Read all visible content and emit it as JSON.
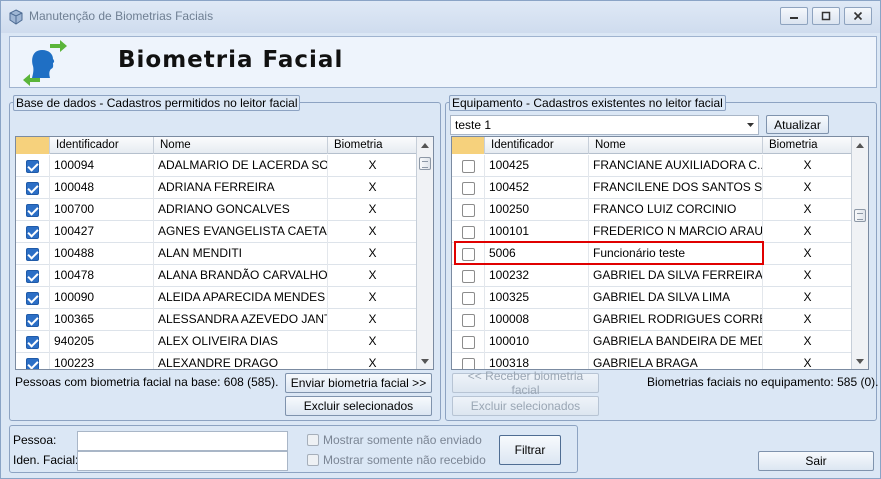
{
  "window": {
    "title": "Manutenção de Biometrias Faciais"
  },
  "header": {
    "title": "Biometria Facial"
  },
  "left_panel": {
    "group_label": "Base de dados - Cadastros permitidos no leitor facial",
    "columns": [
      "Identificador",
      "Nome",
      "Biometria"
    ],
    "rows": [
      {
        "checked": true,
        "id": "100094",
        "name": "ADALMARIO DE LACERDA SO...",
        "bio": "X"
      },
      {
        "checked": true,
        "id": "100048",
        "name": "ADRIANA FERREIRA",
        "bio": "X"
      },
      {
        "checked": true,
        "id": "100700",
        "name": "ADRIANO GONCALVES",
        "bio": "X"
      },
      {
        "checked": true,
        "id": "100427",
        "name": "AGNES EVANGELISTA CAETA...",
        "bio": "X"
      },
      {
        "checked": true,
        "id": "100488",
        "name": "ALAN MENDITI",
        "bio": "X"
      },
      {
        "checked": true,
        "id": "100478",
        "name": "ALANA BRANDÃO CARVALHO",
        "bio": "X"
      },
      {
        "checked": true,
        "id": "100090",
        "name": "ALEIDA APARECIDA MENDES ...",
        "bio": "X"
      },
      {
        "checked": true,
        "id": "100365",
        "name": "ALESSANDRA AZEVEDO JANT...",
        "bio": "X"
      },
      {
        "checked": true,
        "id": "940205",
        "name": "ALEX OLIVEIRA DIAS",
        "bio": "X"
      },
      {
        "checked": true,
        "id": "100223",
        "name": "ALEXANDRE DRAGO",
        "bio": "X"
      }
    ],
    "scroll_position": 0.02,
    "count_label": "Pessoas com biometria facial na base: 608 (585).",
    "send_button": "Enviar biometria facial >>",
    "delete_button": "Excluir selecionados"
  },
  "right_panel": {
    "group_label": "Equipamento - Cadastros existentes no leitor facial",
    "device_select": "teste 1",
    "refresh_button": "Atualizar",
    "columns": [
      "Identificador",
      "Nome",
      "Biometria"
    ],
    "rows": [
      {
        "checked": false,
        "id": "100425",
        "name": "FRANCIANE AUXILIADORA  C...",
        "bio": "X"
      },
      {
        "checked": false,
        "id": "100452",
        "name": "FRANCILENE DOS SANTOS S...",
        "bio": "X"
      },
      {
        "checked": false,
        "id": "100250",
        "name": "FRANCO LUIZ CORCINIO",
        "bio": "X"
      },
      {
        "checked": false,
        "id": "100101",
        "name": "FREDERICO N MARCIO ARAU...",
        "bio": "X"
      },
      {
        "checked": false,
        "id": "5006",
        "name": "Funcionário teste",
        "bio": "X"
      },
      {
        "checked": false,
        "id": "100232",
        "name": "GABRIEL DA SILVA FERREIRA",
        "bio": "X"
      },
      {
        "checked": false,
        "id": "100325",
        "name": "GABRIEL DA SILVA LIMA",
        "bio": "X"
      },
      {
        "checked": false,
        "id": "100008",
        "name": "GABRIEL RODRIGUES CORREIA",
        "bio": "X"
      },
      {
        "checked": false,
        "id": "100010",
        "name": "GABRIELA BANDEIRA DE MED...",
        "bio": "X"
      },
      {
        "checked": false,
        "id": "100318",
        "name": "GABRIELA BRAGA",
        "bio": "X"
      }
    ],
    "scroll_position": 0.3,
    "receive_button": "<< Receber biometria facial",
    "delete_button": "Excluir selecionados",
    "count_label": "Biometrias faciais no equipamento: 585 (0)."
  },
  "filter": {
    "person_label": "Pessoa:",
    "person_value": "",
    "face_id_label": "Iden. Facial:",
    "face_id_value": "",
    "only_not_sent": "Mostrar somente não enviado",
    "only_not_received": "Mostrar somente não recebido",
    "filter_button": "Filtrar"
  },
  "exit_button": "Sair",
  "colors": {
    "highlight": "#e00000",
    "checkbox_checked": "#2c6fc6",
    "selected_header": "#f6d17c"
  }
}
